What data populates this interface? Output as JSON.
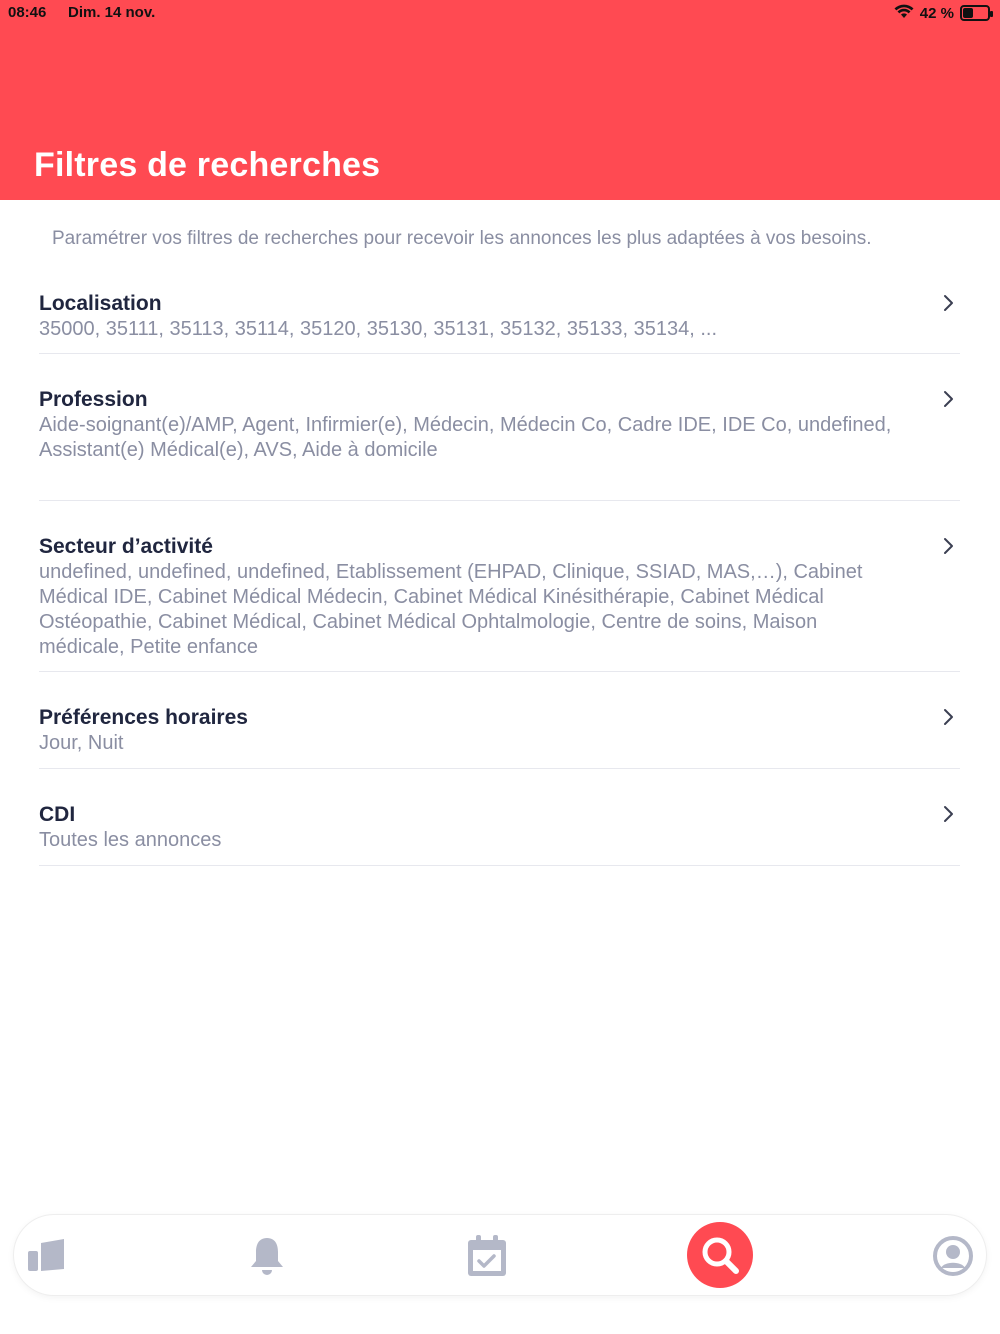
{
  "status_bar": {
    "time": "08:46",
    "date": "Dim. 14 nov.",
    "battery": "42 %",
    "battery_level": 0.42
  },
  "header": {
    "title": "Filtres de recherches",
    "background_color": "#ff4a52"
  },
  "intro": "Paramétrer vos filtres de recherches pour recevoir les annonces les plus adaptées à vos besoins.",
  "filters": [
    {
      "title": "Localisation",
      "value": "35000, 35111, 35113, 35114, 35120, 35130, 35131, 35132, 35133, 35134, ..."
    },
    {
      "title": "Profession",
      "value": "Aide-soignant(e)/AMP, Agent, Infirmier(e), Médecin, Médecin Co, Cadre IDE, IDE Co, undefined, Assistant(e) Médical(e), AVS, Aide à domicile"
    },
    {
      "title": "Secteur d’activité",
      "value": "undefined, undefined, undefined, Etablissement (EHPAD, Clinique, SSIAD, MAS,…), Cabinet Médical IDE, Cabinet Médical Médecin, Cabinet Médical Kinésithérapie, Cabinet Médical Ostéopathie, Cabinet Médical, Cabinet Médical Ophtalmologie, Centre de soins, Maison médicale, Petite enfance"
    },
    {
      "title": "Préférences horaires",
      "value": "Jour, Nuit"
    },
    {
      "title": "CDI",
      "value": "Toutes les annonces"
    }
  ],
  "tabbar": {
    "items": [
      {
        "icon": "cards-icon",
        "active": false
      },
      {
        "icon": "bell-icon",
        "active": false
      },
      {
        "icon": "calendar-check-icon",
        "active": false
      },
      {
        "icon": "search-icon",
        "active": true
      },
      {
        "icon": "profile-icon",
        "active": false
      }
    ],
    "active_color": "#ff4a52",
    "inactive_color": "#b4b8c8"
  }
}
